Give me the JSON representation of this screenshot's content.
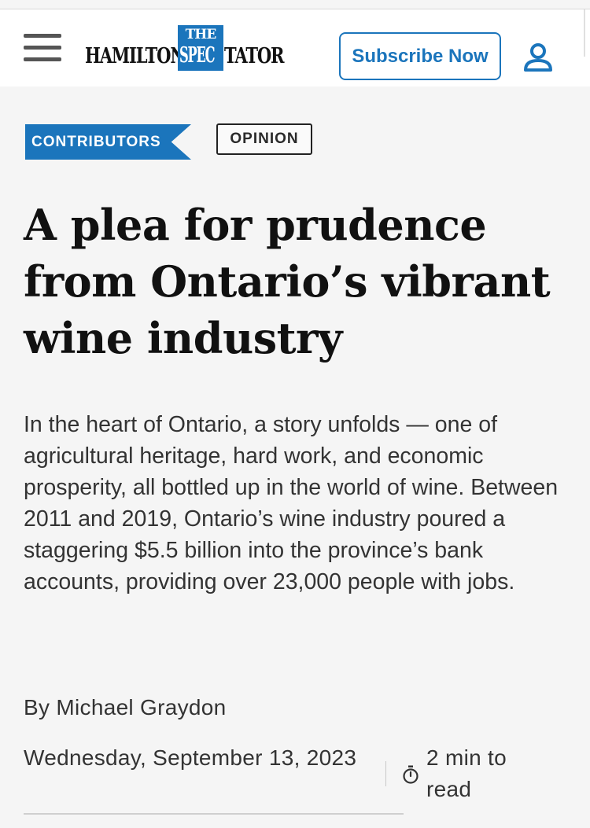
{
  "header": {
    "logo_left": "HAMILTON",
    "logo_the": "THE",
    "logo_spec": "SPEC",
    "logo_right": "TATOR",
    "subscribe_label": "Subscribe Now",
    "menu_icon": "hamburger-menu-icon",
    "account_icon": "user-account-icon",
    "brand_color": "#1b75bc"
  },
  "tags": {
    "section": "CONTRIBUTORS",
    "type": "OPINION"
  },
  "article": {
    "headline": "A plea for prudence from Ontario’s vibrant wine industry",
    "deck": "In the heart of Ontario, a story unfolds — one of agricultural heritage, hard work, and economic prosperity, all bottled up in the world of wine. Between 2011 and 2019, Ontario’s wine industry poured a staggering $5.5 billion into the province’s bank accounts, providing over 23,000 people with jobs.",
    "byline_prefix": "By",
    "author": "Michael Graydon",
    "date": "Wednesday, September 13, 2023",
    "read_time": "2 min to read",
    "read_time_icon": "timer-icon"
  }
}
